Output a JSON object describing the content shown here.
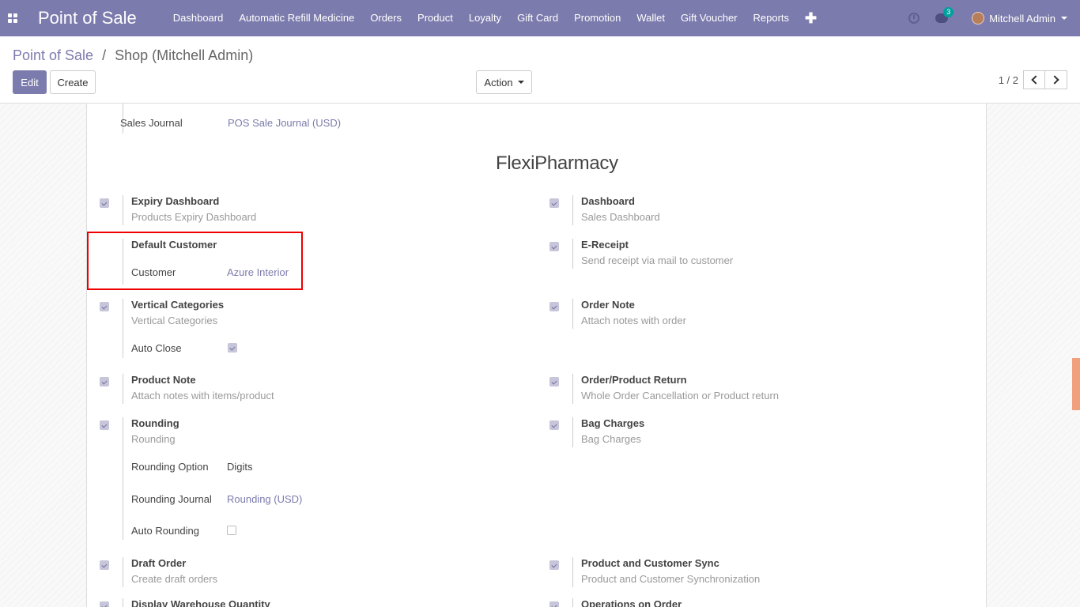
{
  "navbar": {
    "app_title": "Point of Sale",
    "menu": [
      "Dashboard",
      "Automatic Refill Medicine",
      "Orders",
      "Product",
      "Loyalty",
      "Gift Card",
      "Promotion",
      "Wallet",
      "Gift Voucher",
      "Reports"
    ],
    "plus": "✚",
    "chat_count": "3",
    "user_name": "Mitchell Admin"
  },
  "control": {
    "breadcrumb_parent": "Point of Sale",
    "breadcrumb_sep": "/",
    "breadcrumb_current": "Shop (Mitchell Admin)",
    "edit_label": "Edit",
    "create_label": "Create",
    "action_label": "Action",
    "pager_value": "1 / 2"
  },
  "form": {
    "sales_journal_label": "Sales Journal",
    "sales_journal_value": "POS Sale Journal (USD)",
    "section_title": "FlexiPharmacy",
    "settings_left": [
      {
        "title": "Expiry Dashboard",
        "desc": "Products Expiry Dashboard",
        "checked": true
      },
      {
        "title": "Default Customer",
        "desc": "",
        "checked": false
      },
      {
        "title": "Vertical Categories",
        "desc": "Vertical Categories",
        "checked": true
      },
      {
        "title": "Product Note",
        "desc": "Attach notes with items/product",
        "checked": true
      },
      {
        "title": "Rounding",
        "desc": "Rounding",
        "checked": true
      },
      {
        "title": "Draft Order",
        "desc": "Create draft orders",
        "checked": true
      },
      {
        "title": "Display Warehouse Quantity",
        "desc": "",
        "checked": true
      }
    ],
    "settings_right": [
      {
        "title": "Dashboard",
        "desc": "Sales Dashboard",
        "checked": true
      },
      {
        "title": "E-Receipt",
        "desc": "Send receipt via mail to customer",
        "checked": true
      },
      {
        "title": "Order Note",
        "desc": "Attach notes with order",
        "checked": true
      },
      {
        "title": "Order/Product Return",
        "desc": "Whole Order Cancellation or Product return",
        "checked": true
      },
      {
        "title": "Bag Charges",
        "desc": "Bag Charges",
        "checked": true
      },
      {
        "title": "Product and Customer Sync",
        "desc": "Product and Customer Synchronization",
        "checked": true
      },
      {
        "title": "Operations on Order",
        "desc": "",
        "checked": true
      }
    ],
    "customer_label": "Customer",
    "customer_value": "Azure Interior",
    "auto_close_label": "Auto Close",
    "auto_close_checked": true,
    "rounding_option_label": "Rounding Option",
    "rounding_option_value": "Digits",
    "rounding_journal_label": "Rounding Journal",
    "rounding_journal_value": "Rounding (USD)",
    "auto_rounding_label": "Auto Rounding",
    "auto_rounding_checked": false
  }
}
